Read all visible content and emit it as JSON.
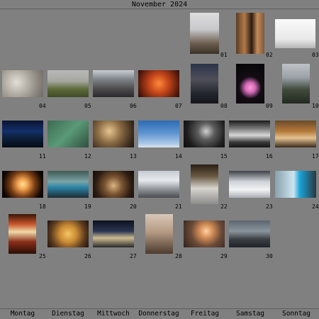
{
  "calendar": {
    "title": "November 2024",
    "weekdays": [
      "Montag",
      "Dienstag",
      "Mittwoch",
      "Donnerstag",
      "Freitag",
      "Samstag",
      "Sonntag"
    ],
    "days": [
      {
        "label": "01",
        "subject": "church-tower-photo"
      },
      {
        "label": "02",
        "subject": "wooden-chair-photo"
      },
      {
        "label": "03",
        "subject": "eyes-sign-photo"
      },
      {
        "label": "04",
        "subject": "foggy-window-photo"
      },
      {
        "label": "05",
        "subject": "misty-field-photo"
      },
      {
        "label": "06",
        "subject": "riverside-street-photo"
      },
      {
        "label": "07",
        "subject": "red-tree-photo"
      },
      {
        "label": "08",
        "subject": "dusk-window-photo"
      },
      {
        "label": "09",
        "subject": "pink-ghost-photo"
      },
      {
        "label": "10",
        "subject": "hill-view-photo"
      },
      {
        "label": "11",
        "subject": "night-river-photo"
      },
      {
        "label": "12",
        "subject": "green-blur-photo"
      },
      {
        "label": "13",
        "subject": "light-ceiling-photo"
      },
      {
        "label": "14",
        "subject": "blue-sky-photo"
      },
      {
        "label": "15",
        "subject": "dark-portrait-photo"
      },
      {
        "label": "16",
        "subject": "reflection-photo"
      },
      {
        "label": "17",
        "subject": "toy-penguin-photo"
      },
      {
        "label": "18",
        "subject": "lamp-photo"
      },
      {
        "label": "19",
        "subject": "blue-lid-photo"
      },
      {
        "label": "20",
        "subject": "restaurant-photo"
      },
      {
        "label": "21",
        "subject": "snowy-trees-photo"
      },
      {
        "label": "22",
        "subject": "snow-figure-photo"
      },
      {
        "label": "23",
        "subject": "snow-pile-photo"
      },
      {
        "label": "24",
        "subject": "blue-device-photo"
      },
      {
        "label": "25",
        "subject": "flower-vase-photo"
      },
      {
        "label": "26",
        "subject": "paella-pan-photo"
      },
      {
        "label": "27",
        "subject": "night-street-photo"
      },
      {
        "label": "28",
        "subject": "white-chair-photo"
      },
      {
        "label": "29",
        "subject": "foggy-light-photo"
      },
      {
        "label": "30",
        "subject": "bridge-railing-photo"
      }
    ]
  }
}
